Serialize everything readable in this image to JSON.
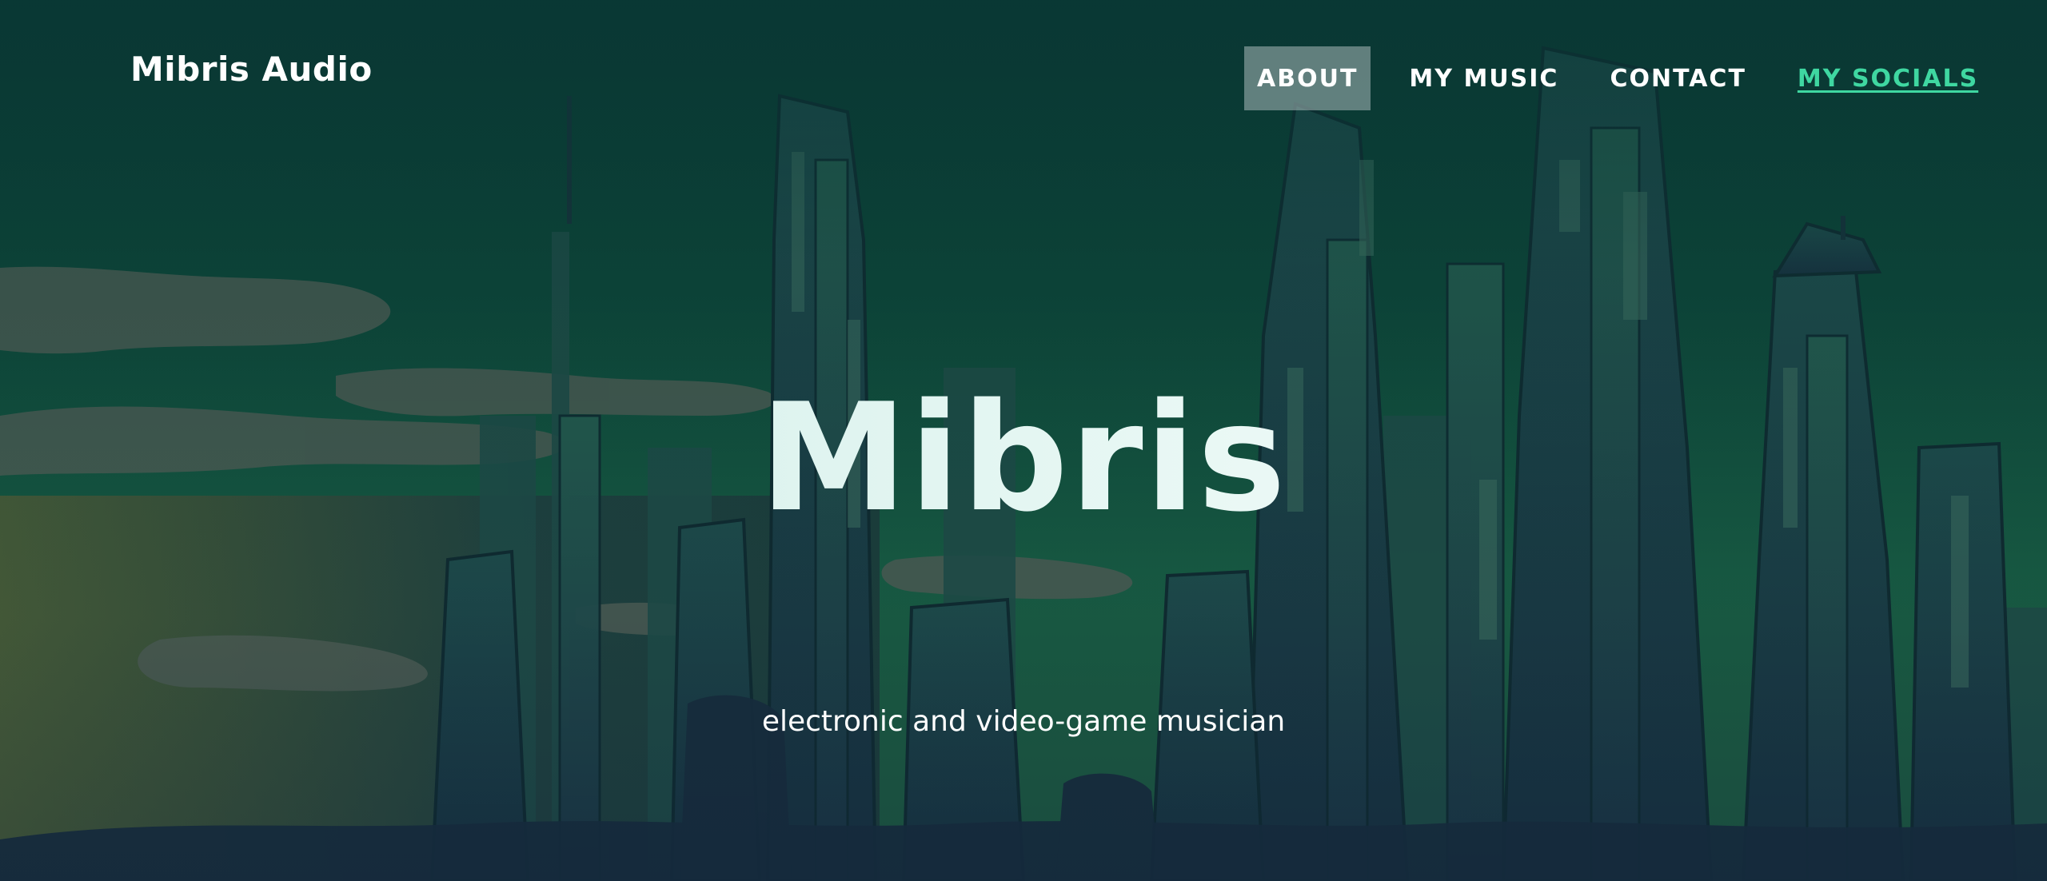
{
  "header": {
    "brand": "Mibris Audio",
    "nav": {
      "about": "ABOUT",
      "music": "MY MUSIC",
      "contact": "CONTACT",
      "socials": "MY SOCIALS"
    },
    "active_item": "about"
  },
  "hero": {
    "title": "Mibris",
    "subtitle": "electronic and video-game musician",
    "background": "illustrated-cityscape-skyline"
  },
  "colors": {
    "sky": "#0b3a36",
    "accent_link": "#3fd7a1",
    "active_nav_bg": "#aab9b9",
    "text": "#ffffff",
    "title_tint": "#d6f1ec"
  }
}
